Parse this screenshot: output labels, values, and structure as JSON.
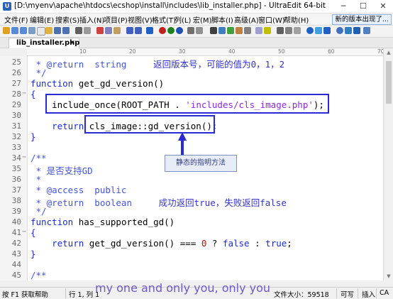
{
  "window": {
    "title": "[D:\\myenv\\apache\\htdocs\\ecshop\\install\\includes\\lib_installer.php] - UltraEdit 64-bit",
    "min": "─",
    "max": "☐",
    "close": "✕"
  },
  "menu": [
    "文件(F)",
    "编辑(E)",
    "搜索(S)",
    "插入(N)",
    "项目(P)",
    "视图(V)",
    "格式(T)",
    "列(L)",
    "宏(M)",
    "脚本(I)",
    "高级(A)",
    "窗口(W)",
    "帮助(H)"
  ],
  "new_version": "新的版本出现了...",
  "tab": {
    "label": "lib_installer.php",
    "close": "×"
  },
  "ruler": [
    "10",
    "20",
    "30",
    "40",
    "50",
    "60",
    "70",
    "80"
  ],
  "line_numbers": [
    "25",
    "26",
    "27",
    "28",
    "29",
    "30",
    "31",
    "32",
    "33",
    "34",
    "35",
    "36",
    "37",
    "38",
    "39",
    "40",
    "41",
    "42",
    "43",
    "44",
    "45"
  ],
  "code": {
    "l25": {
      "a": " * @return  string     ",
      "b": "返回版本号，可能的值为0，1，2"
    },
    "l26": " */",
    "l27": {
      "kw": "function",
      "rest": " get_gd_version()"
    },
    "l28": "{",
    "l29": {
      "pre": "    ",
      "fn": "include_once",
      "p1": "(ROOT_PATH . ",
      "str": "'includes/cls_image.php'",
      "p2": ");"
    },
    "l30": "",
    "l31": {
      "pre": "    ",
      "kw": "return",
      "rest": " cls_image::gd_version();"
    },
    "l32": "}",
    "l33": "",
    "l34": "/**",
    "l35": {
      "a": " * 是否支持GD"
    },
    "l36": " *",
    "l37": " * @access  public",
    "l38": {
      "a": " * @return  boolean     ",
      "b": "成功返回true，失败返回false"
    },
    "l39": " */",
    "l40": {
      "kw": "function",
      "rest": " has_supported_gd()"
    },
    "l41": "{",
    "l42": {
      "pre": "    ",
      "kw": "return",
      "p1": " get_gd_version() === ",
      "num": "0",
      "p2": " ? ",
      "k2": "false",
      "p3": " : ",
      "k3": "true",
      "p4": ";"
    },
    "l43": "}",
    "l44": "",
    "l45": "/**"
  },
  "callout": "静态的指明方法",
  "status": {
    "help": "按 F1 获取帮助",
    "pos": "行 1, 列 1",
    "size": "文件大小：59518",
    "rw": "可写",
    "ins": "插入",
    "caps": "CA"
  },
  "watermark": "my one and only you, only you",
  "colors": {
    "keyword": "#1a2bd0",
    "comment": "#4455d8",
    "string": "#8a2be2",
    "number": "#d40000",
    "annotation_box": "#2b2bd6"
  }
}
